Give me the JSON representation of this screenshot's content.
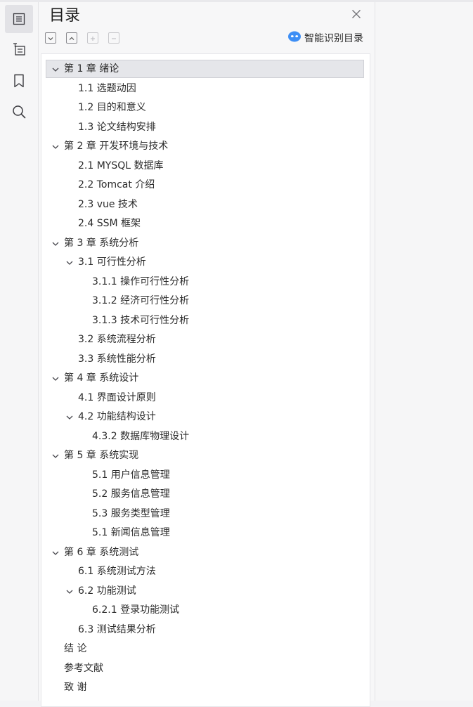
{
  "panel": {
    "title": "目录",
    "smart_label": "智能识别目录"
  },
  "toolbar": {
    "buttons": [
      "collapse-all",
      "expand-all",
      "add-entry",
      "remove-entry"
    ]
  },
  "rail": {
    "items": [
      "toc-icon",
      "outline-icon",
      "bookmark-icon",
      "search-icon"
    ]
  },
  "colors": {
    "accent": "#3d8ef5",
    "selection": "#e5e6ea"
  },
  "toc": [
    {
      "label": "第 1 章  绪论",
      "level": 0,
      "expandable": true,
      "selected": true
    },
    {
      "label": "1.1 选题动因",
      "level": 1
    },
    {
      "label": "1.2 目的和意义",
      "level": 1
    },
    {
      "label": "1.3 论文结构安排",
      "level": 1
    },
    {
      "label": "第 2 章  开发环境与技术",
      "level": 0,
      "expandable": true
    },
    {
      "label": "2.1 MYSQL 数据库",
      "level": 1
    },
    {
      "label": "2.2 Tomcat  介绍",
      "level": 1
    },
    {
      "label": "2.3 vue 技术",
      "level": 1
    },
    {
      "label": "2.4 SSM 框架",
      "level": 1
    },
    {
      "label": "第 3 章  系统分析",
      "level": 0,
      "expandable": true
    },
    {
      "label": "3.1 可行性分析",
      "level": 1,
      "expandable": true
    },
    {
      "label": "3.1.1 操作可行性分析",
      "level": 2
    },
    {
      "label": "3.1.2 经济可行性分析",
      "level": 2
    },
    {
      "label": "3.1.3 技术可行性分析",
      "level": 2
    },
    {
      "label": "3.2 系统流程分析",
      "level": 1
    },
    {
      "label": "3.3 系统性能分析",
      "level": 1
    },
    {
      "label": "第 4 章  系统设计",
      "level": 0,
      "expandable": true
    },
    {
      "label": "4.1 界面设计原则",
      "level": 1
    },
    {
      "label": "4.2 功能结构设计",
      "level": 1,
      "expandable": true
    },
    {
      "label": "4.3.2  数据库物理设计",
      "level": 2
    },
    {
      "label": "第 5 章  系统实现",
      "level": 0,
      "expandable": true
    },
    {
      "label": "5.1 用户信息管理",
      "level": 2
    },
    {
      "label": "5.2  服务信息管理",
      "level": 2
    },
    {
      "label": "5.3 服务类型管理",
      "level": 2
    },
    {
      "label": "5.1 新闻信息管理",
      "level": 2
    },
    {
      "label": "第 6 章  系统测试",
      "level": 0,
      "expandable": true
    },
    {
      "label": "6.1  系统测试方法",
      "level": 1
    },
    {
      "label": "6.2  功能测试",
      "level": 1,
      "expandable": true
    },
    {
      "label": "6.2.1  登录功能测试",
      "level": 2
    },
    {
      "label": "6.3  测试结果分析",
      "level": 1
    },
    {
      "label": "结   论",
      "level": 0
    },
    {
      "label": "参考文献",
      "level": 0
    },
    {
      "label": "致   谢",
      "level": 0
    }
  ]
}
